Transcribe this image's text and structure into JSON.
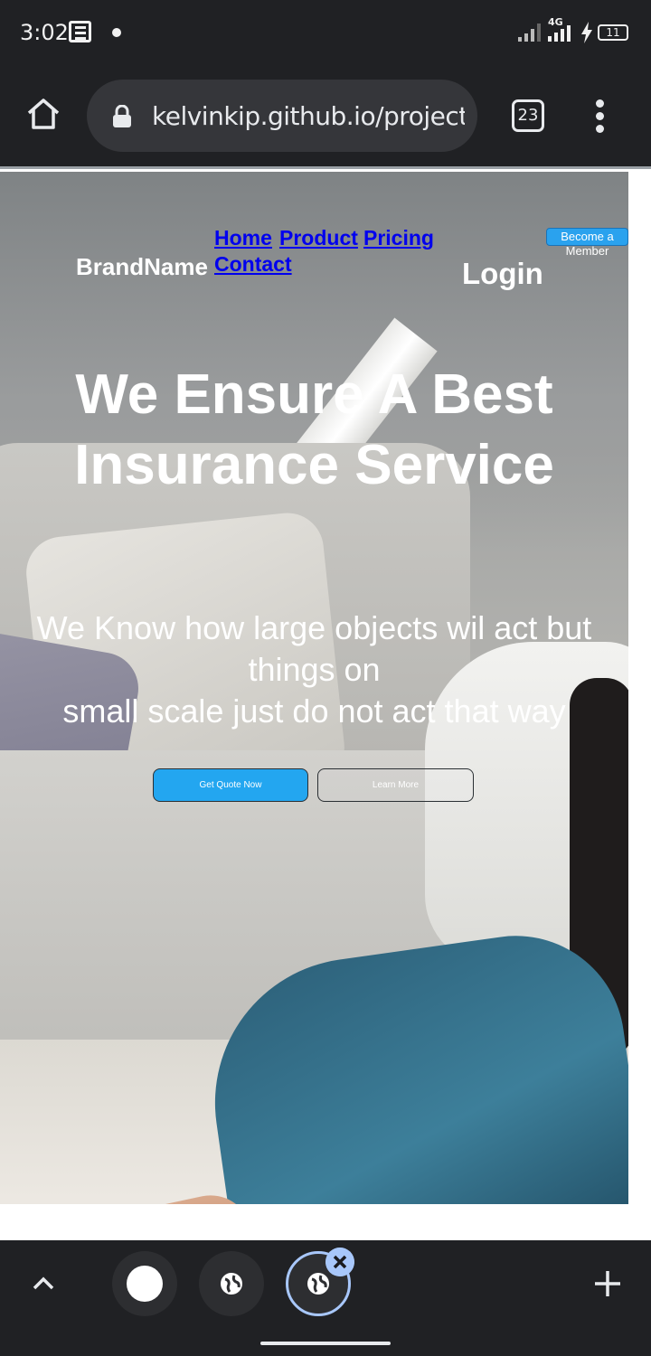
{
  "status_bar": {
    "time": "3:02",
    "network": "4G",
    "battery": "11"
  },
  "browser": {
    "url": "kelvinkip.github.io/project-ins",
    "tab_count": "23"
  },
  "page": {
    "brand": "BrandName",
    "nav": {
      "home": "Home",
      "product": "Product",
      "pricing": "Pricing",
      "contact": "Contact"
    },
    "login": "Login",
    "member_button_line1": "Become a",
    "member_button_line2": "Member",
    "headline_line1": "We Ensure A Best",
    "headline_line2": "Insurance Service",
    "subtext_line1": "We Know how large objects wil act but",
    "subtext_line2": "things on",
    "subtext_line3": "small scale just do not act that way",
    "cta_primary": "Get Quote Now",
    "cta_secondary": "Learn More"
  },
  "colors": {
    "accent": "#23a6f0",
    "link": "#0000ee",
    "chrome_bg": "#202124",
    "active_tab_ring": "#a8c7fa"
  },
  "icons": {
    "home": "home-icon",
    "lock": "lock-icon",
    "tabs": "tab-switcher-icon",
    "menu": "more-vert-icon",
    "chevron": "chevron-up-icon",
    "close": "close-icon",
    "add": "plus-icon"
  }
}
